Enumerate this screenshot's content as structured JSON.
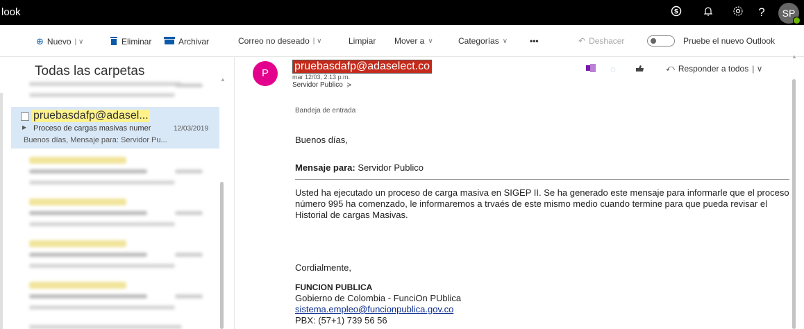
{
  "app": {
    "title": "look"
  },
  "topbar": {
    "icons": [
      "skype-icon",
      "bell-icon",
      "gear-icon",
      "help-icon"
    ],
    "avatar_initials": "SP"
  },
  "toolbar": {
    "new_label": "Nuevo",
    "delete_label": "Eliminar",
    "archive_label": "Archivar",
    "junk_label": "Correo no deseado",
    "sweep_label": "Limpiar",
    "move_label": "Mover a",
    "categories_label": "Categorías",
    "more_label": "•••",
    "undo_label": "Deshacer",
    "try_outlook_label": "Pruebe el nuevo Outlook"
  },
  "folders": {
    "title": "Todas las carpetas"
  },
  "message_list": {
    "selected": {
      "from": "pruebasdafp@adasel...",
      "subject": "Proceso de cargas masivas numer",
      "date": "12/03/2019",
      "preview": "Buenos días,  Mensaje para: Servidor Pu..."
    }
  },
  "reading": {
    "avatar_initial": "P",
    "sender": "pruebasdafp@adaselect.co",
    "sent_date": "mar 12/03, 2:13 p.m.",
    "recipient": "Servidor Publico",
    "reply_all_label": "Responder a todos",
    "folder_label": "Bandeja de entrada",
    "greeting": "Buenos días,",
    "to_label": "Mensaje para:",
    "to_value": " Servidor Publico",
    "paragraph": "Usted ha ejecutado un proceso de carga masiva en SIGEP II. Se ha generado este mensaje para informarle que el proceso número 995 ha comenzado, le informaremos a trvaés de este mismo medio cuando termine para que pueda revisar el Historial de cargas Masivas.",
    "closing": "Cordialmente,",
    "sig_org": "FUNCION PUBLICA",
    "sig_gov": "Gobierno de Colombia - FunciOn PUblica",
    "sig_email": "sistema.empleo@funcionpublica.gov.co",
    "sig_phone": "PBX: (57+1) 739 56 56"
  },
  "colors": {
    "topbar": "#000000",
    "accent": "#0a5aa8",
    "selected_row": "#d9e8f6",
    "sender_avatar": "#e3008c",
    "highlight_yellow": "#fff28a",
    "highlight_red": "#c42b1c"
  }
}
